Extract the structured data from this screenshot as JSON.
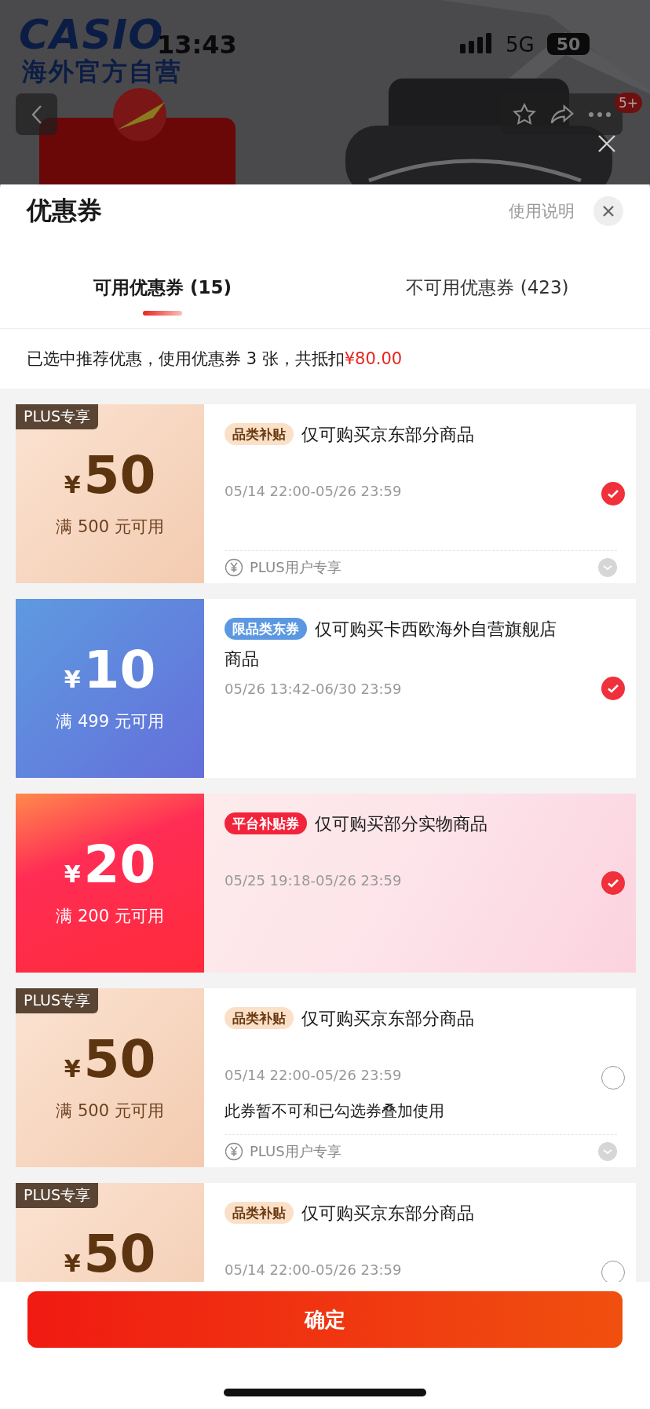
{
  "background_page": {
    "status_bar": {
      "time": "13:43",
      "network": "5G",
      "battery": "50"
    },
    "brand": {
      "logo": "CASIO",
      "subtitle": "海外官方自营"
    },
    "badge": "5+"
  },
  "sheet": {
    "title": "优惠券",
    "help_link": "使用说明",
    "tabs": [
      {
        "label": "可用优惠券 (15)",
        "selected": true
      },
      {
        "label": "不可用优惠券 (423)",
        "selected": false
      }
    ],
    "summary": {
      "text": "已选中推荐优惠，使用优惠券 3 张，共抵扣",
      "amount": "¥80.00"
    },
    "coupons": [
      {
        "kind": "plus",
        "badge": "PLUS专享",
        "currency": "¥",
        "amount": "50",
        "threshold": "满 500 元可用",
        "tag": "品类补贴",
        "title": "仅可购买京东部分商品",
        "period": "05/14 22:00-05/26 23:59",
        "footer": "PLUS用户专享",
        "selected": true
      },
      {
        "kind": "brand",
        "currency": "¥",
        "amount": "10",
        "threshold": "满 499 元可用",
        "tag": "限品类东券",
        "title": "仅可购买卡西欧海外自营旗舰店商品",
        "period": "05/26 13:42-06/30 23:59",
        "selected": true
      },
      {
        "kind": "platform",
        "currency": "¥",
        "amount": "20",
        "threshold": "满 200 元可用",
        "tag": "平台补贴券",
        "title": "仅可购买部分实物商品",
        "period": "05/25 19:18-05/26 23:59",
        "selected": true
      },
      {
        "kind": "plus",
        "badge": "PLUS专享",
        "currency": "¥",
        "amount": "50",
        "threshold": "满 500 元可用",
        "tag": "品类补贴",
        "title": "仅可购买京东部分商品",
        "period": "05/14 22:00-05/26 23:59",
        "note": "此券暂不可和已勾选券叠加使用",
        "footer": "PLUS用户专享",
        "selected": false
      },
      {
        "kind": "plus",
        "badge": "PLUS专享",
        "currency": "¥",
        "amount": "50",
        "tag": "品类补贴",
        "title": "仅可购买京东部分商品",
        "period": "05/14 22:00-05/26 23:59",
        "selected": false
      }
    ],
    "confirm_button": "确定"
  }
}
